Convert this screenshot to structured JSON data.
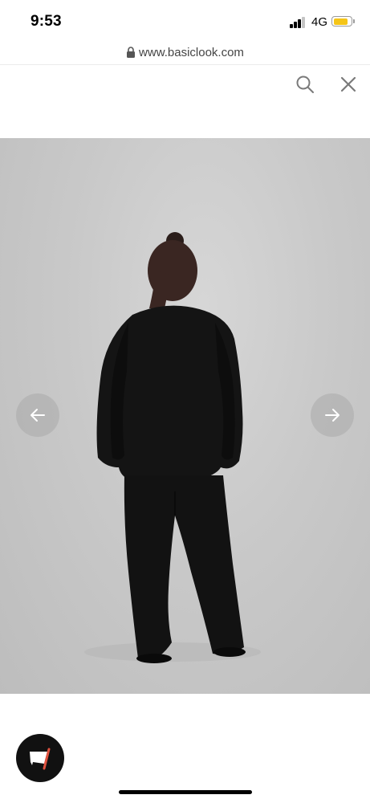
{
  "status_bar": {
    "time": "9:53",
    "network": "4G",
    "battery_level": 0.85,
    "battery_color": "#f5c518"
  },
  "browser": {
    "url": "www.basiclook.com",
    "lock_icon": "lock-icon"
  },
  "header": {
    "search_icon": "search-icon",
    "close_icon": "close-icon"
  },
  "product_gallery": {
    "prev_icon": "arrow-left-icon",
    "next_icon": "arrow-right-icon"
  },
  "chat": {
    "icon": "chat-icon",
    "accent": "#e0523f"
  }
}
